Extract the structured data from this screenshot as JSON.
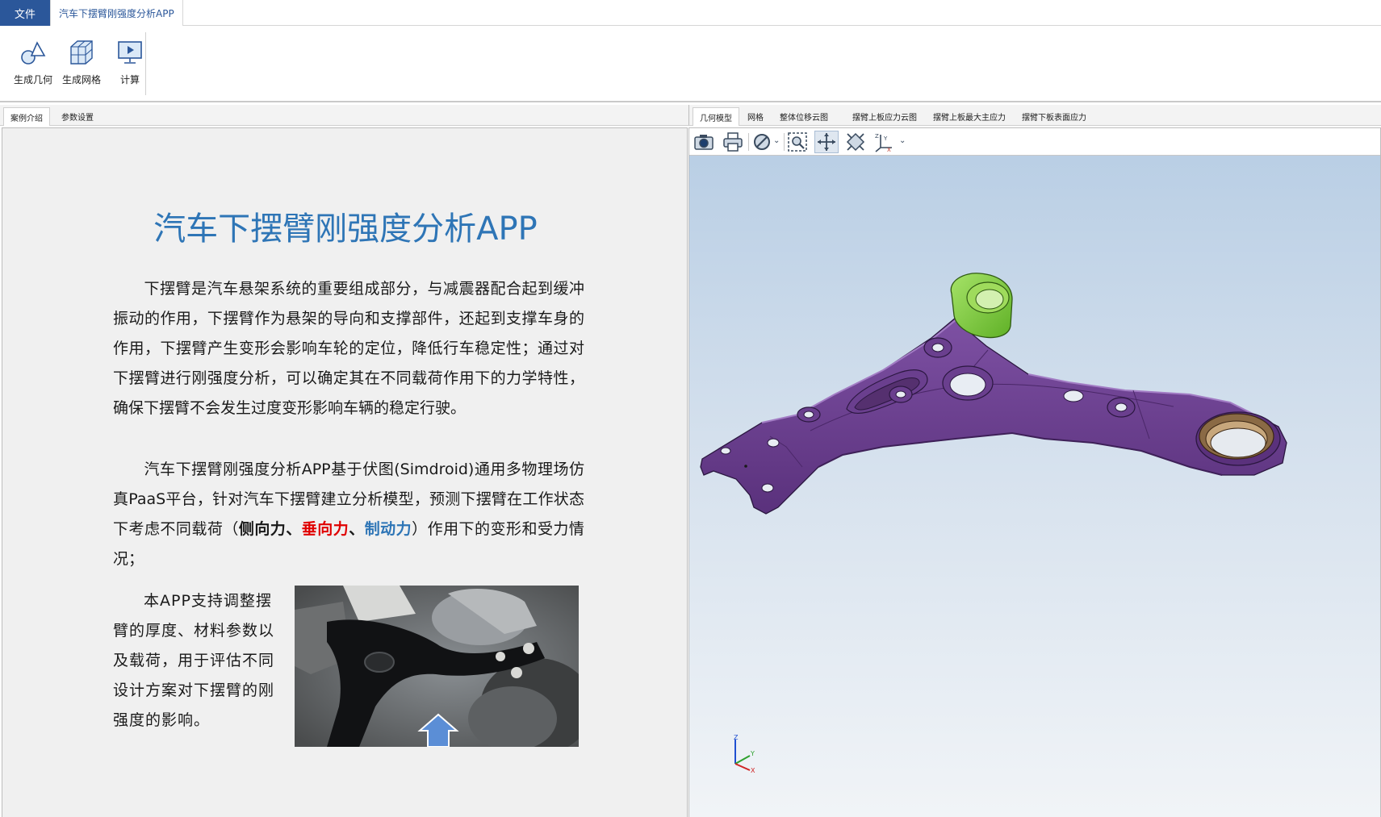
{
  "menubar": {
    "file_label": "文件",
    "app_tab_label": "汽车下摆臂刚强度分析APP"
  },
  "ribbon": {
    "buttons": [
      {
        "label": "生成几何",
        "icon": "geometry-icon"
      },
      {
        "label": "生成网格",
        "icon": "mesh-icon"
      },
      {
        "label": "计算",
        "icon": "compute-icon"
      }
    ]
  },
  "left_tabs": [
    "案例介绍",
    "参数设置"
  ],
  "right_tabs": [
    "几何模型",
    "网格",
    "整体位移云图",
    "摆臂上板应力云图",
    "摆臂上板最大主应力",
    "摆臂下板表面应力"
  ],
  "viewer_toolbar": [
    "camera-icon",
    "print-icon",
    "visibility-icon",
    "zoom-box-icon",
    "pan-icon",
    "fit-view-icon",
    "axis-orientation-icon"
  ],
  "document": {
    "title": "汽车下摆臂刚强度分析APP",
    "para1": "下摆臂是汽车悬架系统的重要组成部分，与减震器配合起到缓冲振动的作用，下摆臂作为悬架的导向和支撑部件，还起到支撑车身的作用，下摆臂产生变形会影响车轮的定位，降低行车稳定性；通过对下摆臂进行刚强度分析，可以确定其在不同载荷作用下的力学特性，确保下摆臂不会发生过度变形影响车辆的稳定行驶。",
    "para2_a": "汽车下摆臂刚强度分析APP基于伏图(Simdroid)通用多物理场仿真PaaS平台，针对汽车下摆臂建立分析模型，预测下摆臂在工作状态下考虑不同载荷（",
    "para2_side": "侧向力",
    "para2_sep1": "、",
    "para2_vertical": "垂向力",
    "para2_sep2": "、",
    "para2_brake": "制动力",
    "para2_b": "）作用下的变形和受力情况；",
    "para3": "本APP支持调整摆臂的厚度、材料参数以及载荷，用于评估不同设计方案对下摆臂的刚强度的影响。"
  },
  "axes": {
    "x": "X",
    "y": "Y",
    "z": "Z"
  },
  "colors": {
    "accent": "#2b579a",
    "title": "#2e75b6",
    "vertical_force": "#e00000",
    "brake_force": "#2e75b6",
    "part_body": "#6b3f8f",
    "bushing": "#84d33a"
  }
}
